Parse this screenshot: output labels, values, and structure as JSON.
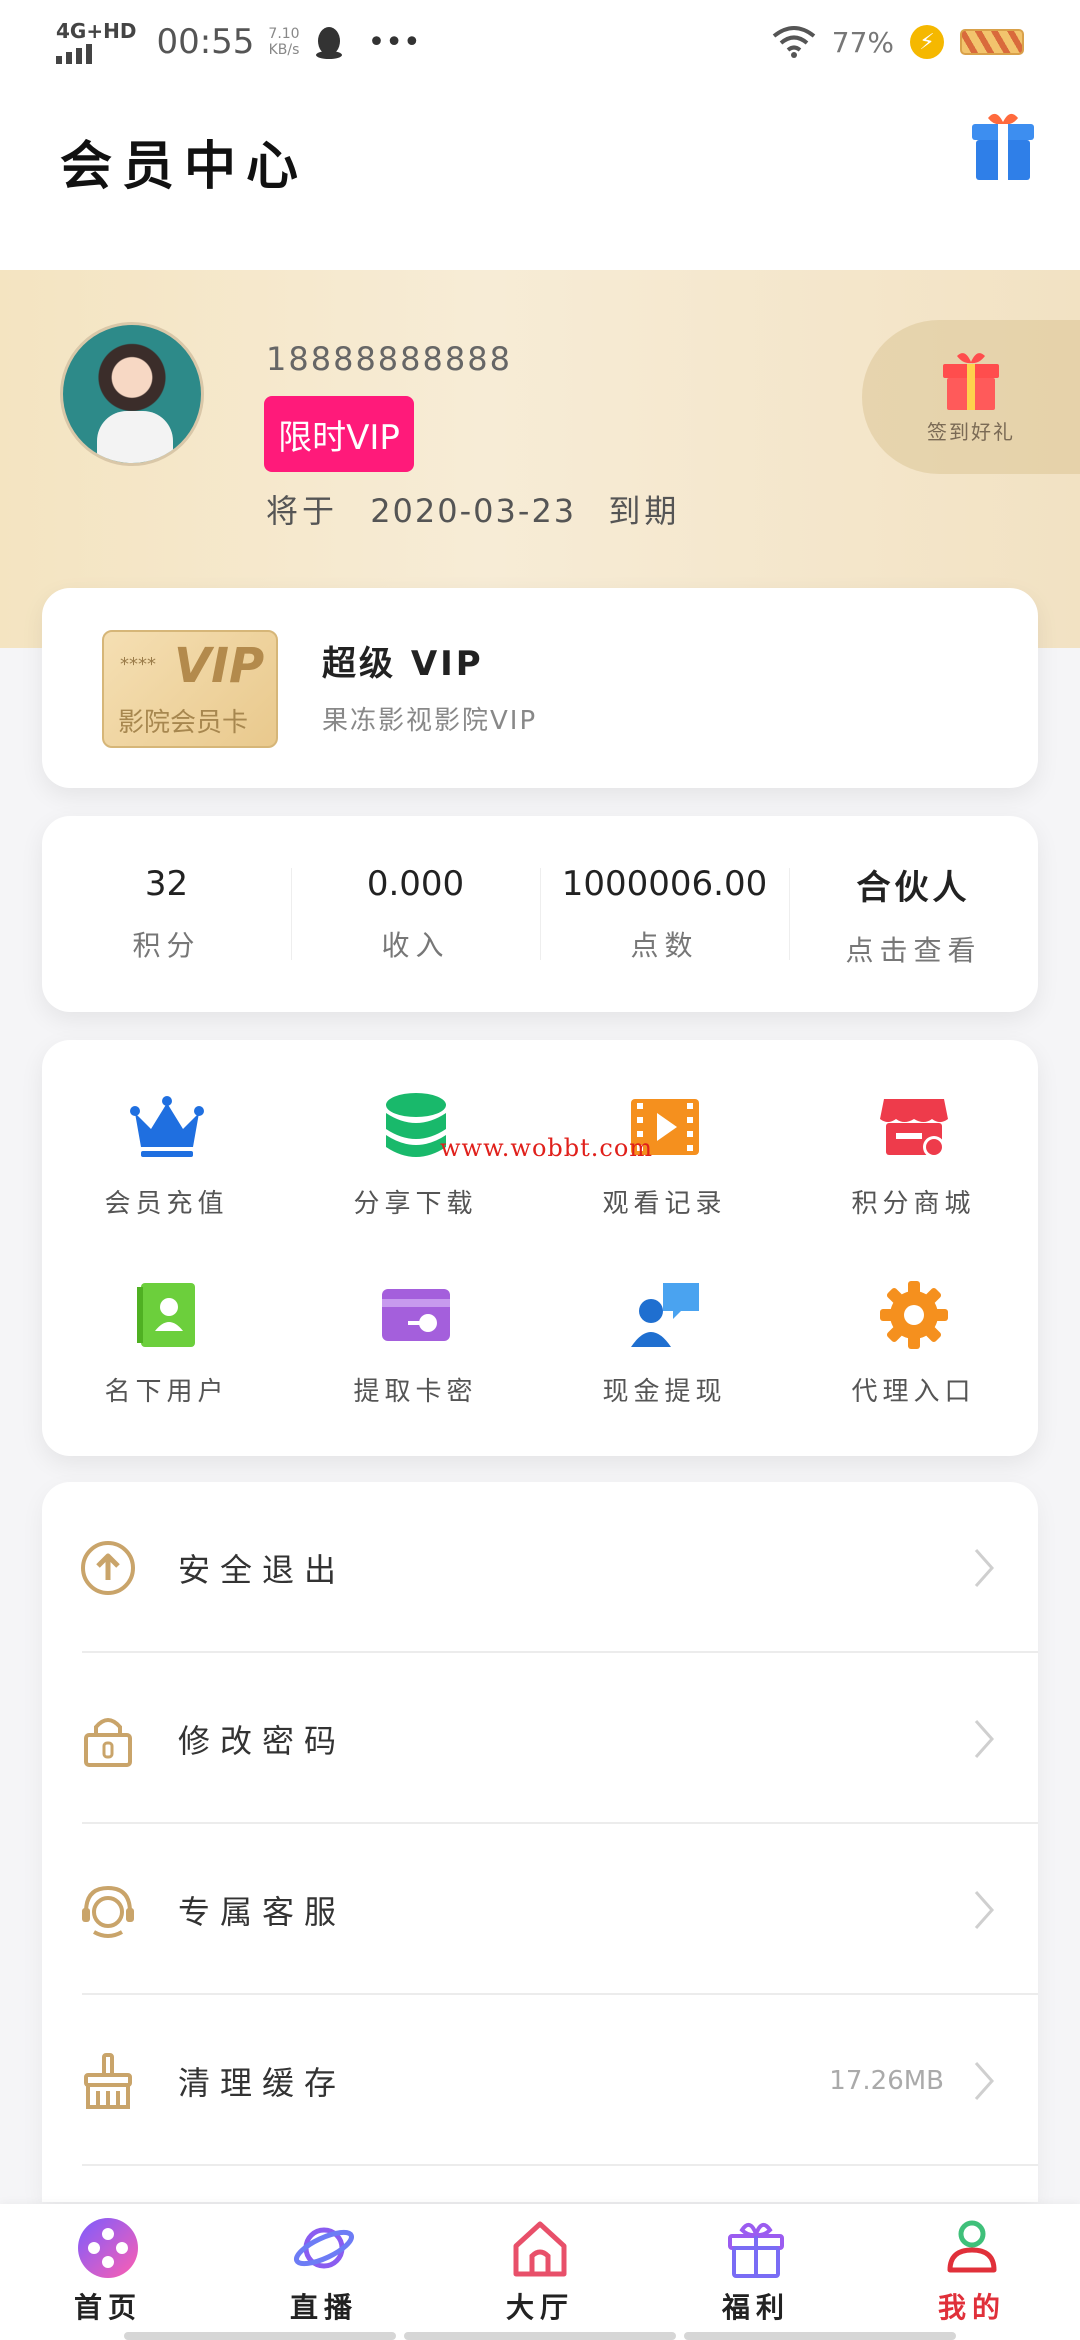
{
  "status_bar": {
    "network": "4G+HD",
    "time": "00:55",
    "speed_value": "7.10",
    "speed_unit": "KB/s",
    "extra": "•••",
    "battery": "77%"
  },
  "header": {
    "title": "会员中心"
  },
  "profile": {
    "phone": "18888888888",
    "vip_badge": "限时VIP",
    "expiry_prefix": "将于",
    "expiry_date": "2020-03-23",
    "expiry_suffix": "到期",
    "checkin_label": "签到好礼"
  },
  "vip_card": {
    "image_stars": "****",
    "image_vip": "VIP",
    "image_name": "影院会员卡",
    "title": "超级 VIP",
    "subtitle": "果冻影视影院VIP"
  },
  "stats": [
    {
      "value": "32",
      "label": "积分"
    },
    {
      "value": "0.000",
      "label": "收入"
    },
    {
      "value": "1000006.00",
      "label": "点数"
    },
    {
      "value": "合伙人",
      "label": "点击查看"
    }
  ],
  "grid": [
    {
      "label": "会员充值",
      "icon": "crown-icon",
      "color": "#1f6fe0"
    },
    {
      "label": "分享下载",
      "icon": "database-icon",
      "color": "#19b96b"
    },
    {
      "label": "观看记录",
      "icon": "film-icon",
      "color": "#f5901e"
    },
    {
      "label": "积分商城",
      "icon": "store-icon",
      "color": "#ee3b4b"
    },
    {
      "label": "名下用户",
      "icon": "contacts-icon",
      "color": "#6ccf3c"
    },
    {
      "label": "提取卡密",
      "icon": "card-key-icon",
      "color": "#a45fdc"
    },
    {
      "label": "现金提现",
      "icon": "user-chat-icon",
      "color": "#2a86e0"
    },
    {
      "label": "代理入口",
      "icon": "gear-icon",
      "color": "#f5901e"
    }
  ],
  "watermark": "www.wobbt.com",
  "menu": [
    {
      "label": "安全退出",
      "value": "",
      "icon": "logout-icon"
    },
    {
      "label": "修改密码",
      "value": "",
      "icon": "lock-icon"
    },
    {
      "label": "专属客服",
      "value": "",
      "icon": "headset-icon"
    },
    {
      "label": "清理缓存",
      "value": "17.26MB",
      "icon": "broom-icon"
    }
  ],
  "bottom_nav": [
    {
      "label": "首页",
      "icon": "film-reel-icon",
      "active": false
    },
    {
      "label": "直播",
      "icon": "planet-icon",
      "active": false
    },
    {
      "label": "大厅",
      "icon": "home-icon",
      "active": false
    },
    {
      "label": "福利",
      "icon": "gift-icon",
      "active": false
    },
    {
      "label": "我的",
      "icon": "profile-icon",
      "active": true
    }
  ],
  "colors": {
    "accent": "#e0303a",
    "vip_badge": "#ff1a7a",
    "gold": "#c9a46a"
  }
}
